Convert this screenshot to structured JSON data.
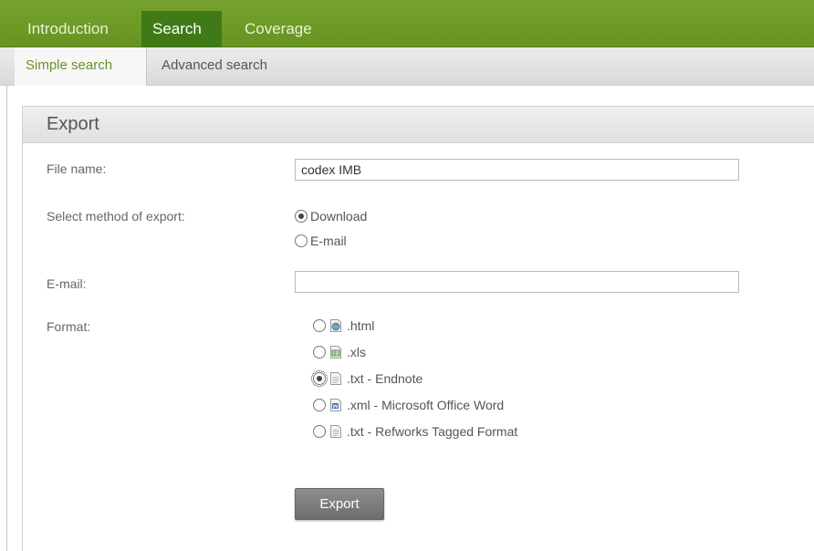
{
  "top_nav": {
    "tabs": [
      {
        "label": "Introduction",
        "active": false
      },
      {
        "label": "Search",
        "active": true
      },
      {
        "label": "Coverage",
        "active": false
      }
    ],
    "color": "#6a9625"
  },
  "sub_nav": {
    "tabs": [
      {
        "label": "Simple search",
        "active": true
      },
      {
        "label": "Advanced search",
        "active": false
      }
    ]
  },
  "export_panel": {
    "title": "Export",
    "file_name": {
      "label": "File name:",
      "value": "codex IMB"
    },
    "export_method": {
      "label": "Select method of export:",
      "options": [
        {
          "label": "Download",
          "checked": true
        },
        {
          "label": "E-mail",
          "checked": false
        }
      ]
    },
    "email": {
      "label": "E-mail:",
      "value": ""
    },
    "format": {
      "label": "Format:",
      "options": [
        {
          "label": ".html",
          "icon": "html-file-icon",
          "checked": false
        },
        {
          "label": ".xls",
          "icon": "excel-file-icon",
          "checked": false
        },
        {
          "label": ".txt - Endnote",
          "icon": "text-file-icon",
          "checked": true
        },
        {
          "label": ".xml - Microsoft Office Word",
          "icon": "word-file-icon",
          "checked": false
        },
        {
          "label": ".txt - Refworks Tagged Format",
          "icon": "text-file-icon",
          "checked": false
        }
      ]
    },
    "button_label": "Export"
  }
}
